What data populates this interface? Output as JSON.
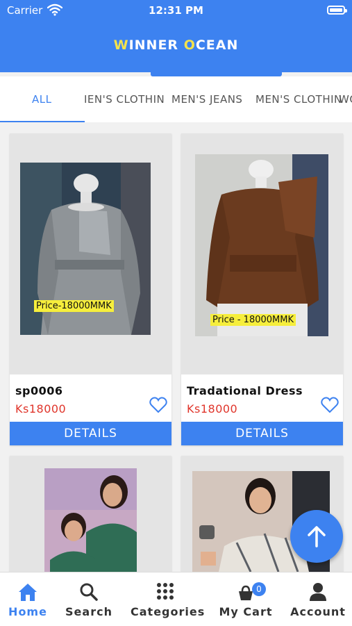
{
  "status_bar": {
    "carrier": "Carrier",
    "time": "12:31 PM"
  },
  "header": {
    "title_part1": "W",
    "title_part2": "INNER ",
    "title_part3": "O",
    "title_part4": "CEAN"
  },
  "tabs": [
    {
      "label": "ALL",
      "active": true
    },
    {
      "label": "IEN'S CLOTHIN"
    },
    {
      "label": "MEN'S JEANS"
    },
    {
      "label": "MEN'S CLOTHIN"
    },
    {
      "label": "WO"
    }
  ],
  "products": [
    {
      "name": "sp0006",
      "price": "Ks18000",
      "image_caption": "Price-18000MMK",
      "details_label": "DETAILS"
    },
    {
      "name": "Tradational Dress",
      "price": "Ks18000",
      "image_caption": "Price - 18000MMK",
      "details_label": "DETAILS"
    }
  ],
  "bottom_nav": [
    {
      "label": "Home",
      "icon": "home-icon",
      "active": true
    },
    {
      "label": "Search",
      "icon": "search-icon"
    },
    {
      "label": "Categories",
      "icon": "grid-icon"
    },
    {
      "label": "My Cart",
      "icon": "cart-icon",
      "badge": "0"
    },
    {
      "label": "Account",
      "icon": "account-icon"
    }
  ],
  "colors": {
    "primary": "#3d82f0",
    "price": "#e0352b",
    "title_accent": "#f4e34b"
  }
}
